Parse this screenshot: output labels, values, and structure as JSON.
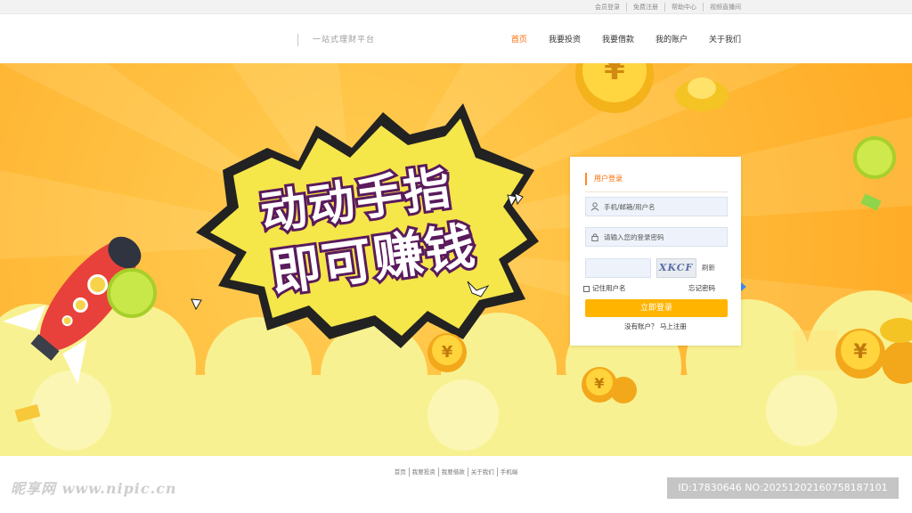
{
  "topbar": {
    "links": [
      "会员登录",
      "免费注册",
      "帮助中心",
      "视频直播间"
    ]
  },
  "header": {
    "slogan": "一站式理财平台",
    "nav": [
      {
        "label": "首页",
        "active": true
      },
      {
        "label": "我要投资",
        "active": false
      },
      {
        "label": "我要借款",
        "active": false
      },
      {
        "label": "我的账户",
        "active": false
      },
      {
        "label": "关于我们",
        "active": false
      }
    ]
  },
  "banner": {
    "headline_line1": "动动手指",
    "headline_line2": "即可赚钱",
    "coin_symbol": "¥",
    "colors": {
      "background": "#ffb52e",
      "cloud": "#f8f191",
      "burst": "#f5e64a"
    }
  },
  "login": {
    "title": "用户登录",
    "username_placeholder": "手机/邮箱/用户名",
    "password_placeholder": "请输入您的登录密码",
    "captcha_text": "XKCF",
    "refresh_label": "刷新",
    "remember_label": "记住用户名",
    "forgot_label": "忘记密码",
    "submit_label": "立即登录",
    "register_label": "没有账户？ 马上注册",
    "accent_color": "#ffb400"
  },
  "footer": {
    "links": [
      "首页",
      "我要投资",
      "我要借款",
      "关于我们",
      "手机端"
    ]
  },
  "watermark": {
    "left": "昵享网 www.nipic.cn",
    "right": "ID:17830646 NO:20251202160758187101"
  }
}
